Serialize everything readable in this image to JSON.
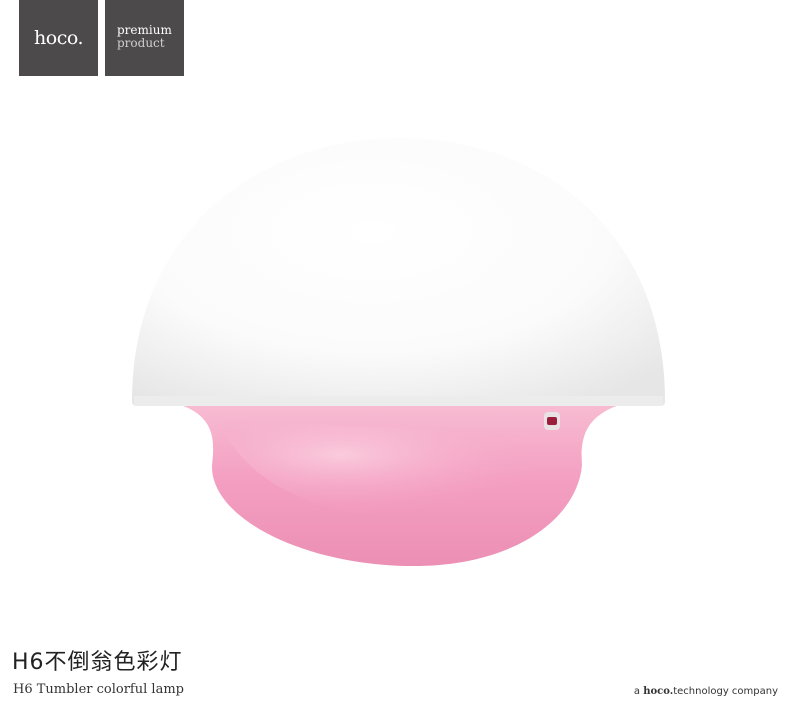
{
  "brand": {
    "logo_text": "hoco.",
    "premium_line1": "premium",
    "premium_line2": "product"
  },
  "product": {
    "title_cn": "H6不倒翁色彩灯",
    "title_en": "H6 Tumbler colorful lamp"
  },
  "footer": {
    "company_prefix": "a ",
    "company_brand": "hoco.",
    "company_suffix": "technology company"
  },
  "colors": {
    "badge_bg": "#4d4a4b",
    "dome": "#ffffff",
    "base_pink": "#f4a3c4"
  }
}
